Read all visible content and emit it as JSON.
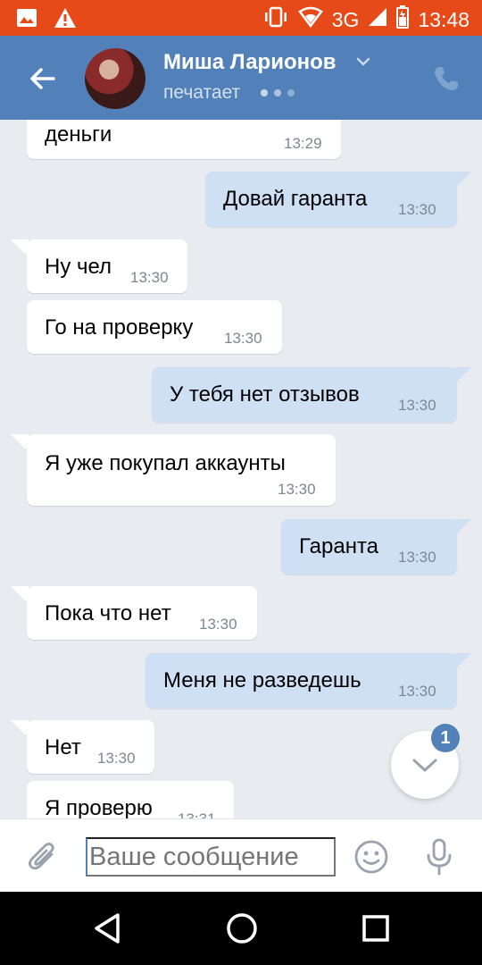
{
  "status_bar": {
    "network": "3G",
    "time": "13:48"
  },
  "header": {
    "contact_name": "Миша Ларионов",
    "status": "печатает"
  },
  "messages": [
    {
      "dir": "in",
      "text": "деньги",
      "time": "13:29"
    },
    {
      "dir": "out",
      "text": "Довай гаранта",
      "time": "13:30"
    },
    {
      "dir": "in",
      "text": "Ну чел",
      "time": "13:30"
    },
    {
      "dir": "in",
      "text": "Го на проверку",
      "time": "13:30"
    },
    {
      "dir": "out",
      "text": "У тебя нет отзывов",
      "time": "13:30"
    },
    {
      "dir": "in",
      "text": "Я уже покупал аккаунты",
      "time": "13:30"
    },
    {
      "dir": "out",
      "text": "Гаранта",
      "time": "13:30"
    },
    {
      "dir": "in",
      "text": "Пока что нет",
      "time": "13:30"
    },
    {
      "dir": "out",
      "text": "Меня не разведешь",
      "time": "13:30"
    },
    {
      "dir": "in",
      "text": "Нет",
      "time": "13:30"
    },
    {
      "dir": "in",
      "text": "Я проверю",
      "time": "13:31"
    }
  ],
  "scroll_down": {
    "badge_count": "1"
  },
  "composer": {
    "placeholder": "Ваше сообщение"
  },
  "colors": {
    "status_bar": "#e64a19",
    "header": "#5181b8",
    "chat_background": "#e8ecf1",
    "incoming_bubble": "#ffffff",
    "outgoing_bubble": "#cfe0f5"
  },
  "icons": {
    "status_left": [
      "image-icon",
      "warning-icon"
    ],
    "status_right": [
      "vibrate-icon",
      "wifi-icon",
      "signal-icon",
      "battery-icon"
    ],
    "header": [
      "back-arrow-icon",
      "chevron-down-icon",
      "phone-icon"
    ],
    "composer": [
      "paperclip-icon",
      "smiley-icon",
      "microphone-icon"
    ],
    "navigation": [
      "nav-back-icon",
      "nav-home-icon",
      "nav-recents-icon"
    ]
  }
}
